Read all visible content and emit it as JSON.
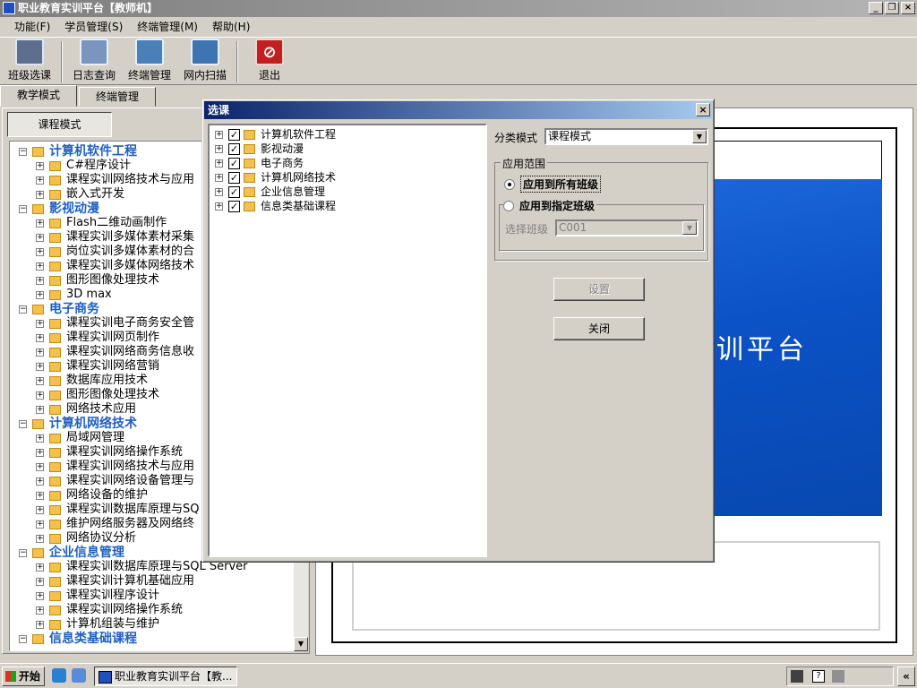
{
  "window": {
    "title": "职业教育实训平台【教师机】"
  },
  "menu": [
    "功能(F)",
    "学员管理(S)",
    "终端管理(M)",
    "帮助(H)"
  ],
  "toolbar": {
    "class_select": "班级选课",
    "log_query": "日志查询",
    "terminal_mgmt": "终端管理",
    "lan_scan": "网内扫描",
    "exit": "退出"
  },
  "tabs": {
    "teaching": "教学模式",
    "terminal": "终端管理"
  },
  "course_mode_button": "课程模式",
  "tree": [
    {
      "label": "计算机软件工程",
      "items": [
        "C#程序设计",
        "课程实训网络技术与应用",
        "嵌入式开发"
      ]
    },
    {
      "label": "影视动漫",
      "items": [
        "Flash二维动画制作",
        "课程实训多媒体素材采集",
        "岗位实训多媒体素材的合",
        "课程实训多媒体网络技术",
        "图形图像处理技术",
        "3D max"
      ]
    },
    {
      "label": "电子商务",
      "items": [
        "课程实训电子商务安全管",
        "课程实训网页制作",
        "课程实训网络商务信息收",
        "课程实训网络营销",
        "数据库应用技术",
        "图形图像处理技术",
        "网络技术应用"
      ]
    },
    {
      "label": "计算机网络技术",
      "items": [
        "局域网管理",
        "课程实训网络操作系统",
        "课程实训网络技术与应用",
        "课程实训网络设备管理与",
        "网络设备的维护",
        "课程实训数据库原理与SQ",
        "维护网络服务器及网络终",
        "网络协议分析"
      ]
    },
    {
      "label": "企业信息管理",
      "items": [
        "课程实训数据库原理与SQL Server",
        "课程实训计算机基础应用",
        "课程实训程序设计",
        "课程实训网络操作系统",
        "计算机组装与维护"
      ]
    },
    {
      "label": "信息类基础课程",
      "items": []
    }
  ],
  "preview": {
    "text": "训平台"
  },
  "dialog": {
    "title": "选课",
    "close": "×",
    "tree": [
      "计算机软件工程",
      "影视动漫",
      "电子商务",
      "计算机网络技术",
      "企业信息管理",
      "信息类基础课程"
    ],
    "category_mode_label": "分类模式",
    "category_mode_value": "课程模式",
    "scope_group": "应用范围",
    "apply_all": "应用到所有班级",
    "apply_specific": "应用到指定班级",
    "select_class_label": "选择班级",
    "select_class_value": "C001",
    "set_button": "设置",
    "close_button": "关闭"
  },
  "taskbar": {
    "start": "开始",
    "task": "职业教育实训平台【教..."
  }
}
